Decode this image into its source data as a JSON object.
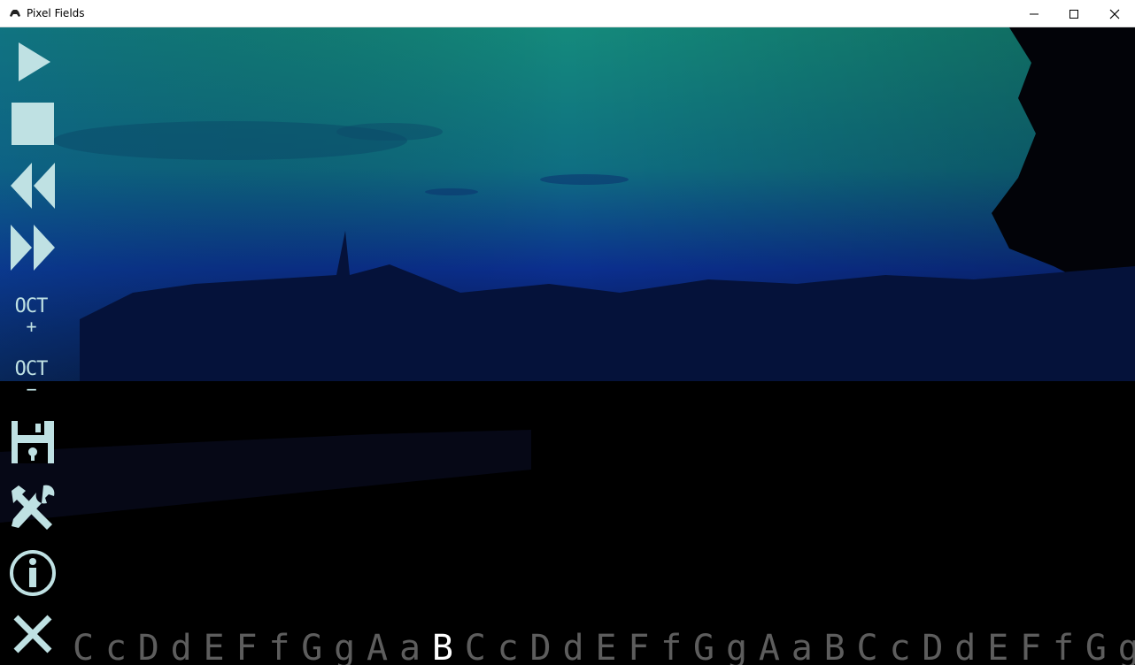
{
  "window": {
    "title": "Pixel Fields",
    "icon": "game-controller-icon",
    "controls": [
      "minimize-icon",
      "maximize-icon",
      "close-icon"
    ]
  },
  "toolbar": {
    "buttons": [
      {
        "name": "play-button",
        "icon": "play-icon"
      },
      {
        "name": "stop-button",
        "icon": "stop-icon"
      },
      {
        "name": "rewind-button",
        "icon": "rewind-icon"
      },
      {
        "name": "fast-forward-button",
        "icon": "fast-forward-icon"
      },
      {
        "name": "save-button",
        "icon": "floppy-disk-icon"
      },
      {
        "name": "settings-button",
        "icon": "tools-icon"
      },
      {
        "name": "info-button",
        "icon": "info-icon"
      },
      {
        "name": "exit-button",
        "icon": "close-x-icon"
      }
    ],
    "octave_up": {
      "line1": "OCT",
      "line2": "+"
    },
    "octave_down": {
      "line1": "OCT",
      "line2": "−"
    }
  },
  "keyboard": {
    "keys": [
      "C",
      "c",
      "D",
      "d",
      "E",
      "F",
      "f",
      "G",
      "g",
      "A",
      "a",
      "B",
      "C",
      "c",
      "D",
      "d",
      "E",
      "F",
      "f",
      "G",
      "g",
      "A",
      "a",
      "B",
      "C",
      "c",
      "D",
      "d",
      "E",
      "F",
      "f",
      "G",
      "g"
    ],
    "active_index": 11
  },
  "colors": {
    "icon": "#bfe1e3",
    "key_inactive": "#5d5d5d",
    "key_active": "#ffffff",
    "wave_start": "#a21ad6",
    "wave_end": "#a8a8a8",
    "sky_top": "#128077",
    "sky_mid": "#0a2a8a",
    "ground": "#000000"
  }
}
